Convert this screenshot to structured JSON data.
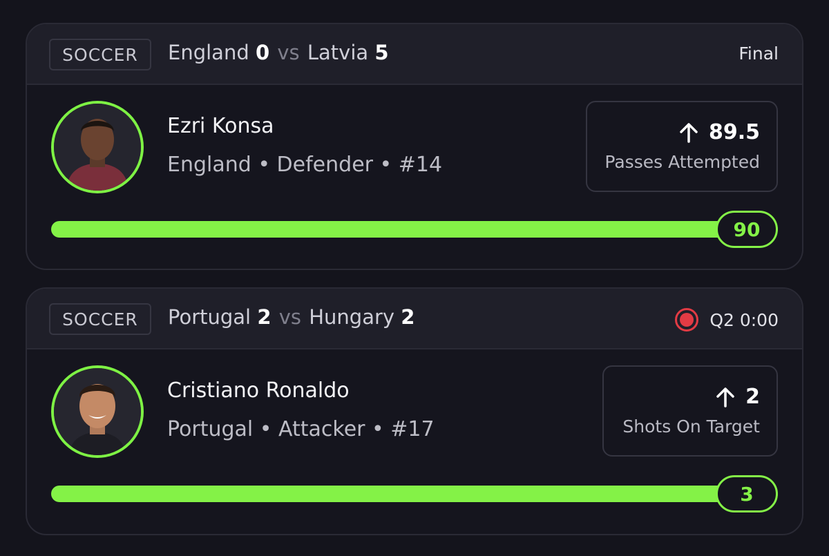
{
  "cards": [
    {
      "sport": "SOCCER",
      "home_team": "England",
      "home_score": "0",
      "vs": "vs",
      "away_team": "Latvia",
      "away_score": "5",
      "status": "Final",
      "live": false,
      "player": {
        "name": "Ezri Konsa",
        "meta": "England • Defender • #14"
      },
      "stat": {
        "direction": "up-arrow-icon",
        "line": "89.5",
        "label": "Passes Attempted"
      },
      "progress": {
        "current": "90",
        "fill_fraction": 1.0
      }
    },
    {
      "sport": "SOCCER",
      "home_team": "Portugal",
      "home_score": "2",
      "vs": "vs",
      "away_team": "Hungary",
      "away_score": "2",
      "status": "Q2 0:00",
      "live": true,
      "player": {
        "name": "Cristiano Ronaldo",
        "meta": "Portugal • Attacker • #17"
      },
      "stat": {
        "direction": "up-arrow-icon",
        "line": "2",
        "label": "Shots On Target"
      },
      "progress": {
        "current": "3",
        "fill_fraction": 1.0
      }
    }
  ],
  "colors": {
    "accent": "#84f247",
    "live": "#e23b44",
    "background": "#14141c",
    "card": "#15151e",
    "card_header": "#1f1f29"
  }
}
